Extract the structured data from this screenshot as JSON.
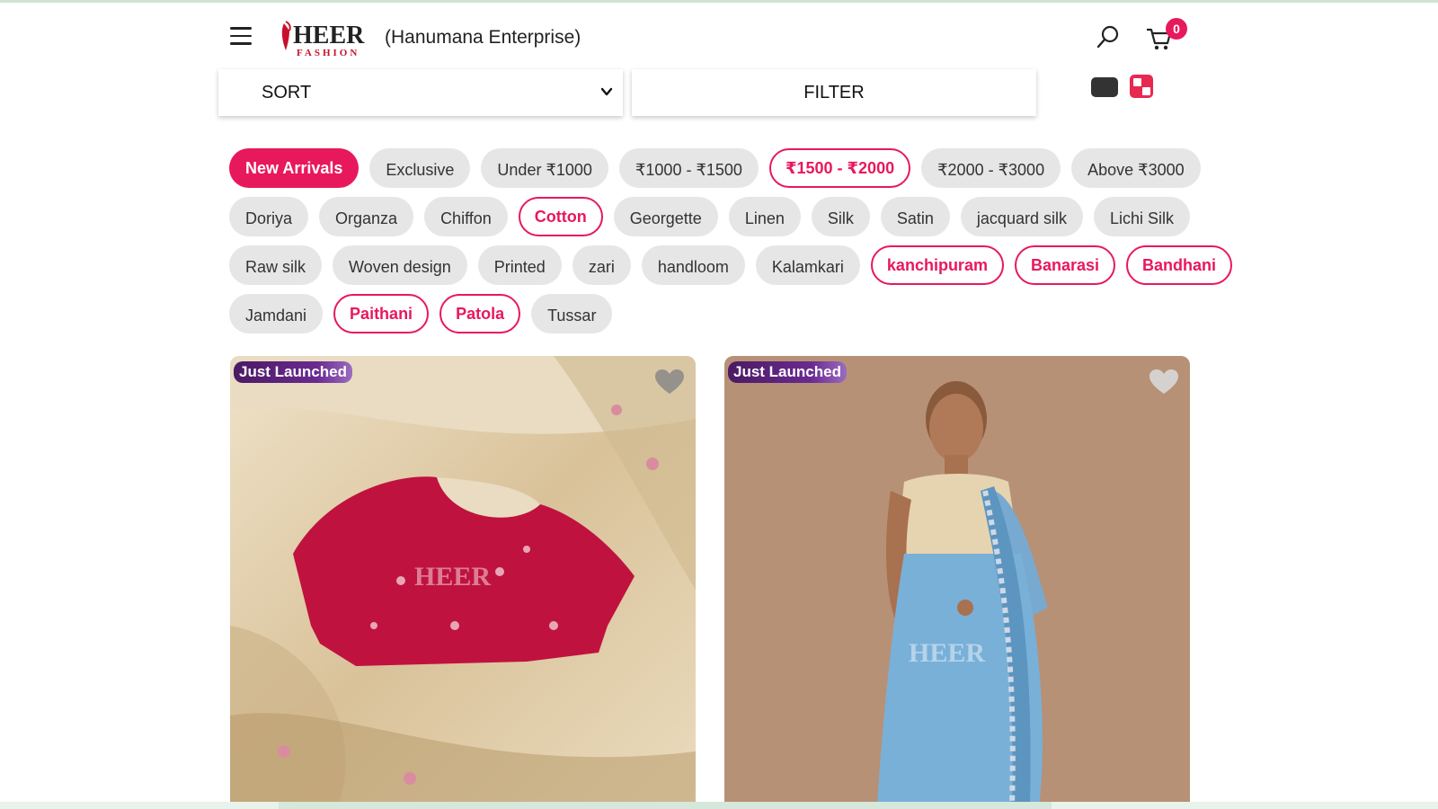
{
  "header": {
    "logo_text": "HEER",
    "logo_subtext": "FASHION",
    "company": "(Hanumana Enterprise)",
    "cart_count": "0"
  },
  "toolbar": {
    "sort_label": "SORT",
    "filter_label": "FILTER"
  },
  "chips": {
    "row1": [
      "New Arrivals",
      "Exclusive",
      "Under ₹1000",
      "₹1000 - ₹1500",
      "₹1500 - ₹2000",
      "₹2000 - ₹3000",
      "Above ₹3000"
    ],
    "row2": [
      "Doriya",
      "Organza",
      "Chiffon",
      "Cotton",
      "Georgette",
      "Linen",
      "Silk",
      "Satin",
      "jacquard silk",
      "Lichi Silk"
    ],
    "row3": [
      "Raw silk",
      "Woven design",
      "Printed",
      "zari",
      "handloom",
      "Kalamkari",
      "kanchipuram",
      "Banarasi",
      "Bandhani"
    ],
    "row4": [
      "Jamdani",
      "Paithani",
      "Patola",
      "Tussar"
    ]
  },
  "products": [
    {
      "tag": "Just Launched",
      "watermark": "HEER"
    },
    {
      "tag": "Just Launched",
      "watermark": "HEER"
    }
  ],
  "colors": {
    "accent": "#e8185c",
    "chip_bg": "#e6e6e6",
    "tag_bg": "#4b1a63"
  },
  "icons": [
    "menu-icon",
    "search-icon",
    "cart-icon",
    "list-view-icon",
    "grid-view-icon",
    "heart-icon",
    "chevron-down-icon"
  ]
}
